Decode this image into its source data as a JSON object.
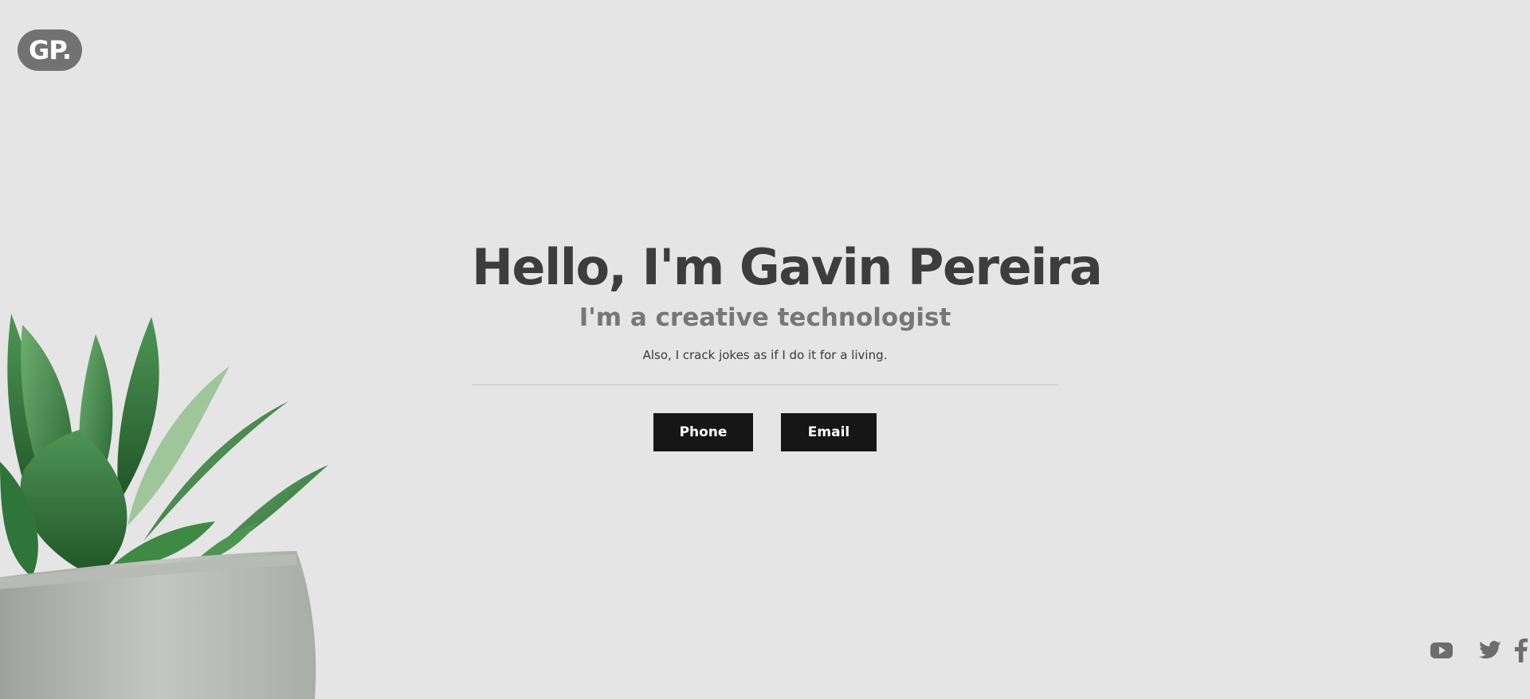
{
  "logo": {
    "text": "GP."
  },
  "hero": {
    "title": "Hello, I'm Gavin Pereira",
    "subtitle": "I'm a creative technologist",
    "tagline": "Also, I crack jokes as if I do it for a living."
  },
  "buttons": {
    "phone_label": "Phone",
    "email_label": "Email"
  },
  "social": [
    {
      "icon": "youtube-icon"
    },
    {
      "icon": "twitter-icon"
    },
    {
      "icon": "facebook-icon"
    }
  ],
  "colors": {
    "background": "#e5e5e5",
    "title": "#3d3d3d",
    "subtitle": "#777777",
    "button": "#161616",
    "logo_bg": "#727272",
    "icon": "#6d6d6d"
  }
}
